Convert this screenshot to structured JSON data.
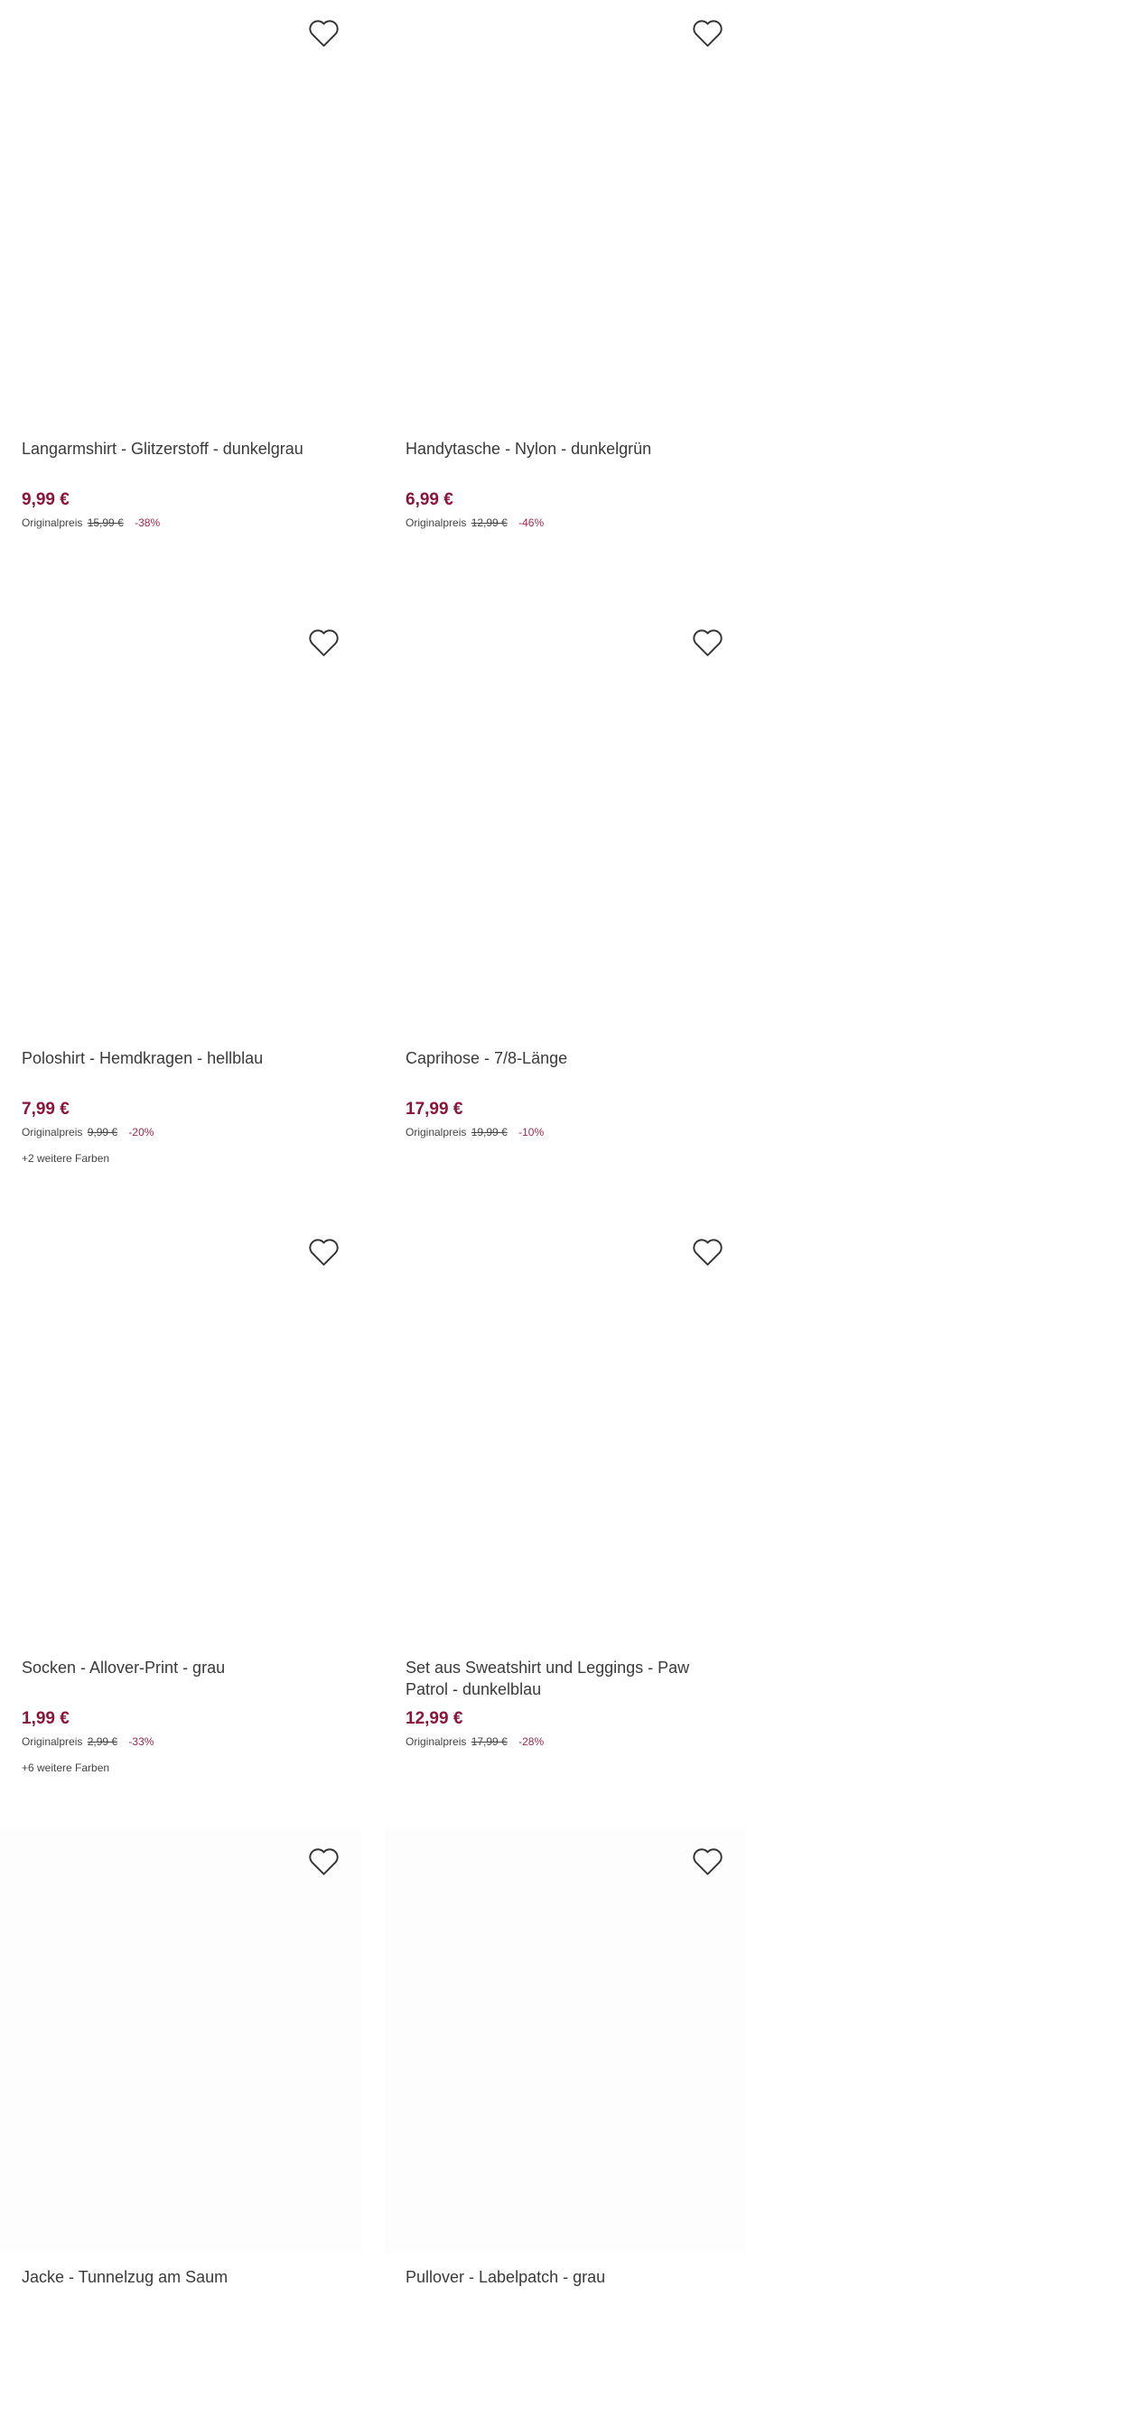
{
  "products": [
    {
      "title": "Langarmshirt - Glitzerstoff - dunkelgrau",
      "price": "9,99 €",
      "orig_label": "Originalpreis",
      "orig_price": "15,99 €",
      "discount": "-38%",
      "more_colors": ""
    },
    {
      "title": "Handytasche - Nylon - dunkelgrün",
      "price": "6,99 €",
      "orig_label": "Originalpreis",
      "orig_price": "12,99 €",
      "discount": "-46%",
      "more_colors": ""
    },
    {
      "title": "Poloshirt - Hemdkragen - hellblau",
      "price": "7,99 €",
      "orig_label": "Originalpreis",
      "orig_price": "9,99 €",
      "discount": "-20%",
      "more_colors": "+2 weitere Farben"
    },
    {
      "title": "Caprihose - 7/8-Länge",
      "price": "17,99 €",
      "orig_label": "Originalpreis",
      "orig_price": "19,99 €",
      "discount": "-10%",
      "more_colors": ""
    },
    {
      "title": "Socken - Allover-Print - grau",
      "price": "1,99 €",
      "orig_label": "Originalpreis",
      "orig_price": "2,99 €",
      "discount": "-33%",
      "more_colors": "+6 weitere Farben"
    },
    {
      "title": "Set aus Sweatshirt und Leggings - Paw Patrol - dunkelblau",
      "price": "12,99 €",
      "orig_label": "Originalpreis",
      "orig_price": "17,99 €",
      "discount": "-28%",
      "more_colors": ""
    },
    {
      "title": "Jacke - Tunnelzug am Saum",
      "price": "",
      "orig_label": "",
      "orig_price": "",
      "discount": "",
      "more_colors": ""
    },
    {
      "title": "Pullover - Labelpatch - grau",
      "price": "",
      "orig_label": "",
      "orig_price": "",
      "discount": "",
      "more_colors": ""
    }
  ],
  "icons": {
    "wishlist": "heart-outline-icon"
  },
  "colors": {
    "price": "#8a1538",
    "discount": "#a0284a",
    "text": "#3a3a3a"
  }
}
